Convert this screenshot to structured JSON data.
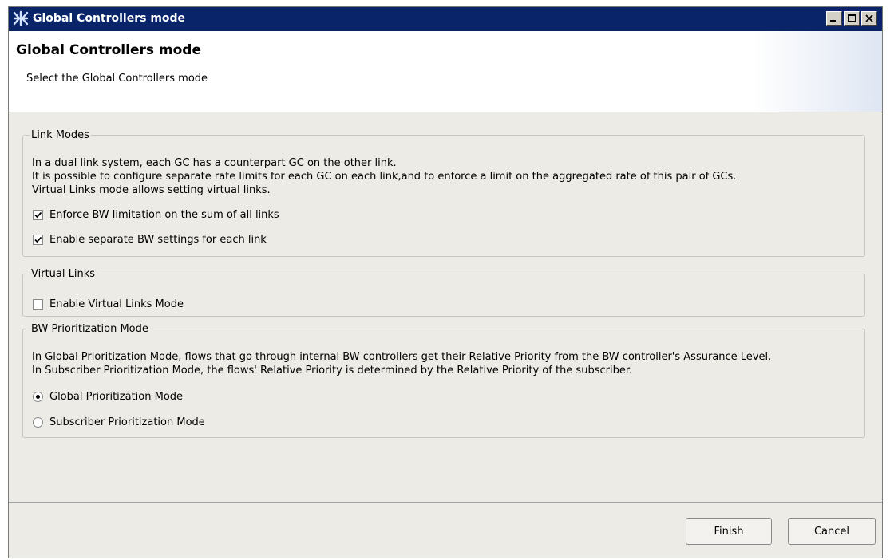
{
  "window": {
    "title": "Global Controllers mode",
    "icon": "app-icon"
  },
  "header": {
    "title": "Global Controllers mode",
    "subtitle": "Select the Global Controllers mode"
  },
  "link_modes": {
    "legend": "Link Modes",
    "desc": [
      "In a dual link system, each GC has a counterpart GC on the other link.",
      "It is possible to configure separate rate limits for each GC on each link,and to enforce a limit on the aggregated rate of this pair of GCs.",
      "Virtual Links mode allows setting virtual links."
    ],
    "options": [
      {
        "label": "Enforce BW limitation on the sum of all links",
        "checked": true
      },
      {
        "label": "Enable separate BW settings for each link",
        "checked": true
      }
    ]
  },
  "virtual_links": {
    "legend": "Virtual Links",
    "options": [
      {
        "label": "Enable Virtual Links Mode",
        "checked": false
      }
    ]
  },
  "bw_prioritization": {
    "legend": "BW Prioritization Mode",
    "desc": [
      "In Global Prioritization Mode, flows that go through internal BW controllers get their Relative Priority from the BW controller's Assurance Level.",
      "In Subscriber Prioritization Mode, the flows' Relative Priority is determined by the Relative Priority of the subscriber."
    ],
    "options": [
      {
        "label": "Global Prioritization Mode",
        "selected": true
      },
      {
        "label": "Subscriber Prioritization Mode",
        "selected": false
      }
    ]
  },
  "footer": {
    "finish_label": "Finish",
    "cancel_label": "Cancel"
  },
  "colors": {
    "titlebar": "#0a246a",
    "dialog_bg": "#ecebe6"
  }
}
